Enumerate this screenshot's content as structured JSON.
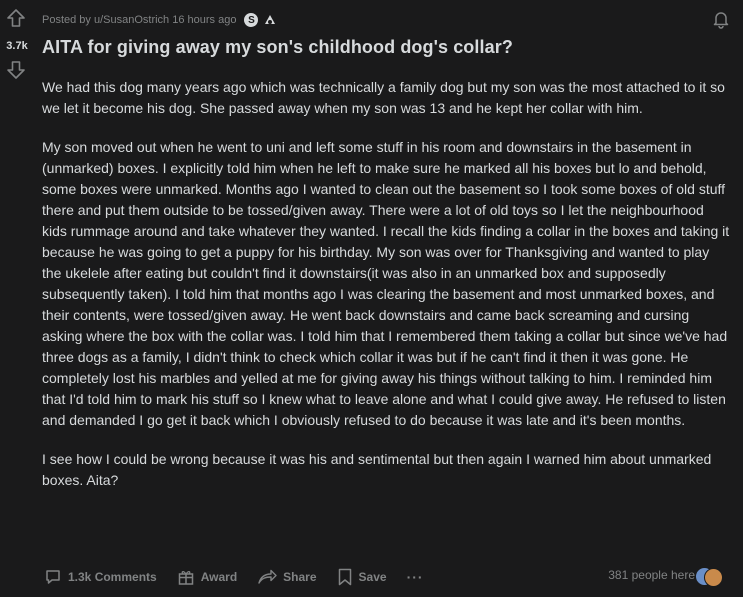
{
  "post": {
    "meta": "Posted by u/SusanOstrich 16 hours ago",
    "vote_count": "3.7k",
    "title": "AITA for giving away my son's childhood dog's collar?",
    "paragraphs": [
      "We had this dog many years ago which was technically a family dog but my son was the most attached to it so we let it become his dog. She passed away when my son was 13 and he kept her collar with him.",
      "My son moved out when he went to uni and left some stuff in his room and downstairs in the basement in (unmarked) boxes. I explicitly told him when he left to make sure he marked all his boxes but lo and behold, some boxes were unmarked. Months ago I wanted to clean out the basement so I took some boxes of old stuff there and put them outside to be tossed/given away. There were a lot of old toys so I let the neighbourhood kids rummage around and take whatever they wanted. I recall the kids finding a collar in the boxes and taking it because he was going to get a puppy for his birthday. My son was over for Thanksgiving and wanted to play the ukelele after eating but couldn't find it downstairs(it was also in an unmarked box and supposedly subsequently taken). I told him that months ago I was clearing the basement and most unmarked boxes, and their contents, were tossed/given away. He went back downstairs and came back screaming and cursing asking where the box with the collar was. I told him that I remembered them taking a collar but since we've had three dogs as a family, I didn't think to check which collar it was but if he can't find it then it was gone. He completely lost his marbles and yelled at me for giving away his things without talking to him. I reminded him that I'd told him to mark his stuff so I knew what to leave alone and what I could give away. He refused to listen and demanded I go get it back which I obviously refused to do because it was late and it's been months.",
      "I see how I could be wrong because it was his and sentimental but then again I warned him about unmarked boxes. Aita?"
    ]
  },
  "award_a_glyph": "S",
  "actions": {
    "comments": "1.3k Comments",
    "award": "Award",
    "share": "Share",
    "save": "Save",
    "more": "···"
  },
  "viewers": "381 people here",
  "icons": [
    "upvote-icon",
    "downvote-icon",
    "bell-icon",
    "comment-icon",
    "award-icon",
    "share-icon",
    "save-icon",
    "more-icon"
  ],
  "colors": {
    "background": "#1a1a1b",
    "text": "#d7dadc",
    "muted": "#818384"
  }
}
